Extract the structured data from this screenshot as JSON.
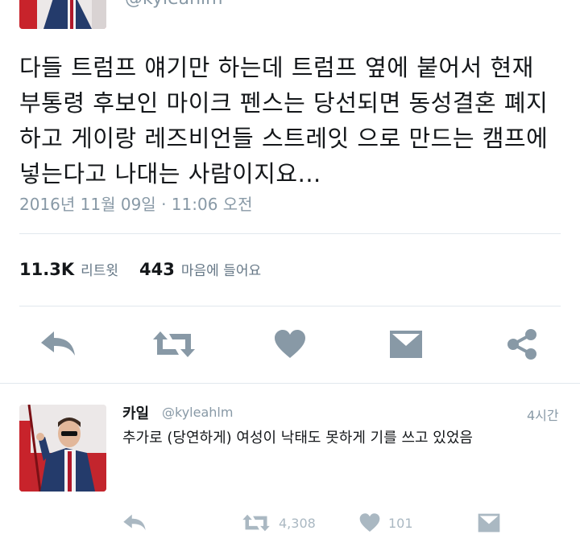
{
  "main_tweet": {
    "handle": "@kyleahlm",
    "text_lines": [
      "다들 트럼프 얘기만 하는데 트럼프 옆에 붙어서 현재",
      "부통령 후보인 마이크 펜스는 당선되면 동성결혼 폐지",
      "하고 게이랑 레즈비언들 스트레잇 으로 만드는 캠프에",
      "넣는다고 나대는 사람이지요..."
    ],
    "timestamp": "2016년 11월 09일 · 11:06 오전",
    "retweet_count": "11.3K",
    "retweet_label": "리트윗",
    "like_count": "443",
    "like_label": "마음에 들어요"
  },
  "actions": [
    "reply-icon",
    "retweet-icon",
    "like-icon",
    "dm-icon",
    "share-icon"
  ],
  "reply": {
    "name": "카일",
    "handle": "@kyleahlm",
    "time": "4시간",
    "text": "추가로 (당연하게) 여성이 낙태도 못하게 기를 쓰고 있었음",
    "retweet_count": "4,308",
    "like_count": "101"
  },
  "colors": {
    "icon": "#8899a6",
    "secondary_text": "#8899a6",
    "divider": "#e1e8ed"
  }
}
